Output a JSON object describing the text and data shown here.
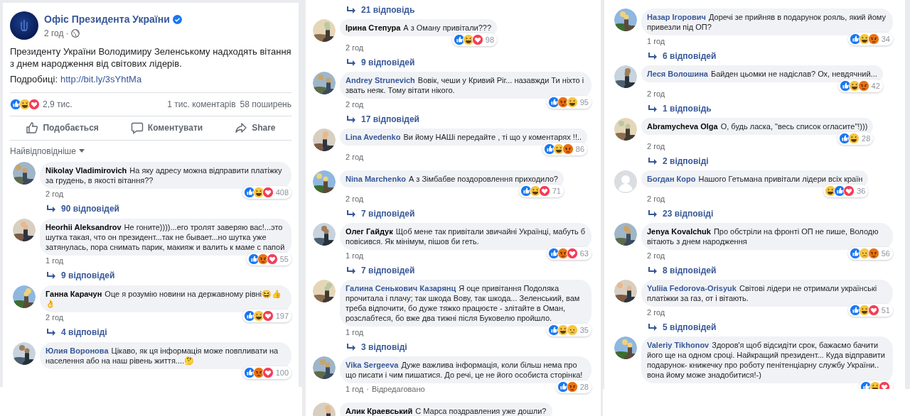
{
  "columns": [
    {
      "post": {
        "author": "Офіс Президента України",
        "verified": true,
        "time": "2 год",
        "separator": "·",
        "text": "Президенту України Володимиру Зеленському надходять вітання з днем народження від світових лідерів.",
        "details_label": "Подробиці:",
        "link": "http://bit.ly/3sYhtMa",
        "reactions": [
          {
            "kind": "like"
          },
          {
            "kind": "haha"
          },
          {
            "kind": "love"
          }
        ],
        "reaction_count": "2,9 тис.",
        "comments": "1 тис. коментарів",
        "shares": "58 поширень",
        "actions": [
          {
            "kind": "like",
            "label": "Подобається"
          },
          {
            "kind": "comment",
            "label": "Коментувати"
          },
          {
            "kind": "share",
            "label": "Share"
          }
        ],
        "sort_label": "Найвідповідніше"
      },
      "items": [
        {
          "kind": "comment",
          "author": "Nikolay Vladimirovich",
          "color": "#050505",
          "avatar": {
            "kind": "picture"
          },
          "text": "На яку адресу можна відправити платіжку за грудень, в якості вітання??",
          "time": "2 год",
          "reactions": [
            {
              "kind": "like"
            },
            {
              "kind": "haha"
            },
            {
              "kind": "love"
            }
          ],
          "reaction_count": "408"
        },
        {
          "kind": "replies",
          "label": "90 відповідей"
        },
        {
          "kind": "comment",
          "author": "Heorhii Aleksandrov",
          "color": "#050505",
          "avatar": {
            "kind": "picture"
          },
          "text": "Не гоните))))...его тролят заверяю вас!...это шутка такая, что он президент...так не бывает...но шутка уже затянулась, пора снимать парик, макияж и валить к маме с папой",
          "time": "1 год",
          "reactions": [
            {
              "kind": "like"
            },
            {
              "kind": "angry"
            },
            {
              "kind": "love"
            }
          ],
          "reaction_count": "55"
        },
        {
          "kind": "replies",
          "label": "9 відповідей"
        },
        {
          "kind": "comment",
          "author": "Ганна Карачун",
          "color": "#050505",
          "avatar": {
            "kind": "picture"
          },
          "text": "Оце я розумію новини на державному рівні😆👍 👌",
          "time": "2 год",
          "reactions": [
            {
              "kind": "like"
            },
            {
              "kind": "haha"
            },
            {
              "kind": "love"
            }
          ],
          "reaction_count": "197"
        },
        {
          "kind": "replies",
          "label": "4 відповіді"
        },
        {
          "kind": "comment",
          "author": "Юлия Воронова",
          "color": "#385898",
          "avatar": {
            "kind": "picture"
          },
          "text": "Цікаво, як ця інформація може повпливати на населення або на наш рівень життя....🤔",
          "reactions": [
            {
              "kind": "like"
            },
            {
              "kind": "angry"
            },
            {
              "kind": "love"
            }
          ],
          "reaction_count": "100"
        }
      ]
    },
    {
      "items": [
        {
          "kind": "replies",
          "label": "21 відповідь"
        },
        {
          "kind": "comment",
          "author": "Ірина Степура",
          "color": "#050505",
          "avatar": {
            "kind": "picture"
          },
          "text": "А з Оману привітали???",
          "time": "2 год",
          "reactions": [
            {
              "kind": "like"
            },
            {
              "kind": "haha"
            },
            {
              "kind": "love"
            }
          ],
          "reaction_count": "98"
        },
        {
          "kind": "replies",
          "label": "9 відповідей"
        },
        {
          "kind": "comment",
          "author": "Andrey Strunevich",
          "color": "#385898",
          "avatar": {
            "kind": "picture"
          },
          "text": "Вовік, чеши у Кривий Ріг... назавжди Ти ніхто і звать неяк. Тому вітати нікого.",
          "time": "2 год",
          "reactions": [
            {
              "kind": "like"
            },
            {
              "kind": "angry"
            },
            {
              "kind": "haha"
            }
          ],
          "reaction_count": "95"
        },
        {
          "kind": "replies",
          "label": "17 відповідей"
        },
        {
          "kind": "comment",
          "author": "Lina Avedenko",
          "color": "#385898",
          "avatar": {
            "kind": "picture"
          },
          "text": "Ви йому НАШі передайте , ті що у коментарях !!..",
          "time": "2 год",
          "reactions": [
            {
              "kind": "like"
            },
            {
              "kind": "haha"
            },
            {
              "kind": "angry"
            }
          ],
          "reaction_count": "86"
        },
        {
          "kind": "comment",
          "author": "Nina Marchenko",
          "color": "#385898",
          "avatar": {
            "kind": "picture"
          },
          "text": "А з Зімбабве поздоровлення приходило?",
          "time": "2 год",
          "reactions": [
            {
              "kind": "like"
            },
            {
              "kind": "haha"
            },
            {
              "kind": "love"
            }
          ],
          "reaction_count": "71"
        },
        {
          "kind": "replies",
          "label": "7 відповідей"
        },
        {
          "kind": "comment",
          "author": "Олег Гайдук",
          "color": "#050505",
          "avatar": {
            "kind": "picture"
          },
          "text": "Щоб мене так привітали звичайні Українці, мабуть б повісився. Як мінімум, пішов би геть.",
          "time": "1 год",
          "reactions": [
            {
              "kind": "like"
            },
            {
              "kind": "angry"
            },
            {
              "kind": "love"
            }
          ],
          "reaction_count": "63"
        },
        {
          "kind": "replies",
          "label": "7 відповідей"
        },
        {
          "kind": "comment",
          "author": "Галина Сенькович Казарянц",
          "color": "#385898",
          "avatar": {
            "kind": "picture"
          },
          "text": "Я оце привітання Подоляка прочитала і плачу; так шкода Вову, так шкода... Зеленський, вам треба відпочити, бо дуже тяжко працюєте - злітайте в Оман, розслабтеся, бо вже два тижні після Буковелю пройшло.",
          "time": "1 год",
          "reactions": [
            {
              "kind": "like"
            },
            {
              "kind": "haha"
            },
            {
              "kind": "sad"
            }
          ],
          "reaction_count": "35"
        },
        {
          "kind": "replies",
          "label": "3 відповіді"
        },
        {
          "kind": "comment",
          "author": "Vika Sergeeva",
          "color": "#385898",
          "avatar": {
            "kind": "picture"
          },
          "text": "Дуже важлива інформація, коли більш нема про що писати і чим пишатися. До речі, це не його особиста сторінка!",
          "time": "1 год",
          "separator": "·",
          "edited": "Відредаговано",
          "reactions": [
            {
              "kind": "like"
            },
            {
              "kind": "angry"
            }
          ],
          "reaction_count": "28"
        },
        {
          "kind": "comment",
          "author": "Алик Краевський",
          "color": "#050505",
          "avatar": {
            "kind": "picture"
          },
          "text": "С Марса поздравления уже дошли?"
        }
      ]
    },
    {
      "items": [
        {
          "kind": "comment",
          "author": "Назар Ігорович",
          "color": "#385898",
          "avatar": {
            "kind": "picture"
          },
          "text": "Доречі зе прийняв в подарунок рояль, який йому привезли під ОП?",
          "time": "1 год",
          "reactions": [
            {
              "kind": "like"
            },
            {
              "kind": "haha"
            },
            {
              "kind": "angry"
            }
          ],
          "reaction_count": "34"
        },
        {
          "kind": "replies",
          "label": "6 відповідей"
        },
        {
          "kind": "comment",
          "author": "Леся Волошина",
          "color": "#385898",
          "avatar": {
            "kind": "picture"
          },
          "text": "Байден цьомки не надіслав? Ох, невдячний...",
          "time": "2 год",
          "reactions": [
            {
              "kind": "like"
            },
            {
              "kind": "haha"
            },
            {
              "kind": "angry"
            }
          ],
          "reaction_count": "42"
        },
        {
          "kind": "replies",
          "label": "1 відповідь"
        },
        {
          "kind": "comment",
          "author": "Abramycheva Olga",
          "color": "#050505",
          "avatar": {
            "kind": "picture"
          },
          "text": "О, будь ласка, \"весь список огласите\"!)))",
          "time": "2 год",
          "reactions": [
            {
              "kind": "like"
            },
            {
              "kind": "haha"
            }
          ],
          "reaction_count": "28"
        },
        {
          "kind": "replies",
          "label": "2 відповіді"
        },
        {
          "kind": "comment",
          "author": "Богдан Коро",
          "color": "#385898",
          "avatar": {
            "kind": "default"
          },
          "text": "Нашого Гетьмана привітали лідери всіх країн",
          "time": "2 год",
          "reactions": [
            {
              "kind": "haha"
            },
            {
              "kind": "like"
            },
            {
              "kind": "love"
            }
          ],
          "reaction_count": "36"
        },
        {
          "kind": "replies",
          "label": "23 відповіді"
        },
        {
          "kind": "comment",
          "author": "Jenya Kovalchuk",
          "color": "#050505",
          "avatar": {
            "kind": "picture"
          },
          "text": "Про обстріли на фронті ОП не пише, Володю вітають з днем народження",
          "time": "2 год",
          "reactions": [
            {
              "kind": "like"
            },
            {
              "kind": "sad"
            },
            {
              "kind": "angry"
            }
          ],
          "reaction_count": "56"
        },
        {
          "kind": "replies",
          "label": "8 відповідей"
        },
        {
          "kind": "comment",
          "author": "Yuliia Fedorova-Orisyuk",
          "color": "#385898",
          "avatar": {
            "kind": "picture"
          },
          "text": "Світові лідери не отримали українські платіжки за газ, от і вітають.",
          "time": "2 год",
          "reactions": [
            {
              "kind": "like"
            },
            {
              "kind": "haha"
            },
            {
              "kind": "love"
            }
          ],
          "reaction_count": "51"
        },
        {
          "kind": "replies",
          "label": "5 відповідей"
        },
        {
          "kind": "comment",
          "author": "Valeriy Tikhonov",
          "color": "#385898",
          "avatar": {
            "kind": "picture"
          },
          "text": "Здоров'я щоб відсидіти срок, бажаємо бачити його ще на одном сроці. Найкращий президент... Куда відправити подарунок- книжечку про роботу пенітенціарну службу України.. вона йому може знадобитися!-)",
          "reactions": [
            {
              "kind": "like"
            },
            {
              "kind": "haha"
            },
            {
              "kind": "love"
            }
          ]
        }
      ]
    }
  ]
}
